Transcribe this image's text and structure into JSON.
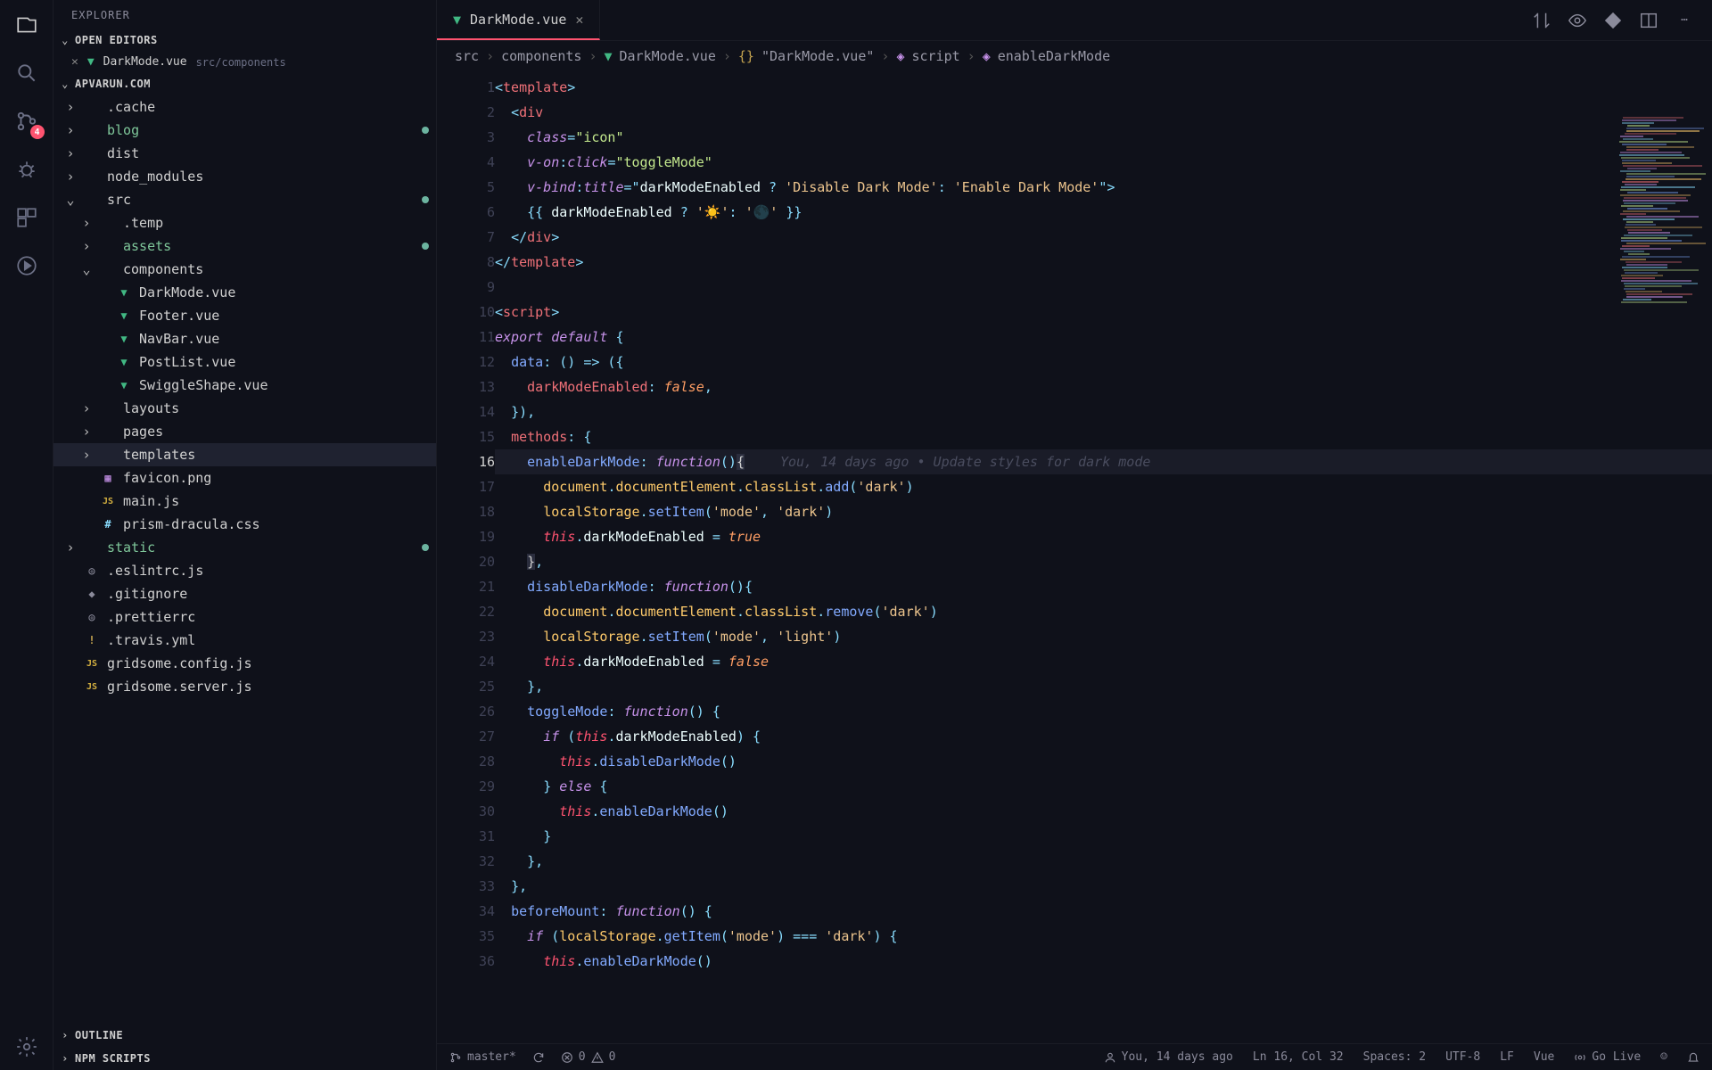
{
  "sidebar": {
    "title": "EXPLORER",
    "openEditorsLabel": "OPEN EDITORS",
    "openEditor": {
      "name": "DarkMode.vue",
      "path": "src/components"
    },
    "projectLabel": "APVARUN.COM",
    "outlineLabel": "OUTLINE",
    "npmLabel": "NPM SCRIPTS",
    "scmBadge": "4",
    "tree": [
      {
        "name": ".cache",
        "type": "folder",
        "depth": 0,
        "expanded": false
      },
      {
        "name": "blog",
        "type": "folder",
        "depth": 0,
        "expanded": false,
        "modified": true,
        "green": true
      },
      {
        "name": "dist",
        "type": "folder",
        "depth": 0,
        "expanded": false
      },
      {
        "name": "node_modules",
        "type": "folder",
        "depth": 0,
        "expanded": false
      },
      {
        "name": "src",
        "type": "folder",
        "depth": 0,
        "expanded": true,
        "modified": true
      },
      {
        "name": ".temp",
        "type": "folder",
        "depth": 1,
        "expanded": false
      },
      {
        "name": "assets",
        "type": "folder",
        "depth": 1,
        "expanded": false,
        "modified": true,
        "green": true
      },
      {
        "name": "components",
        "type": "folder",
        "depth": 1,
        "expanded": true
      },
      {
        "name": "DarkMode.vue",
        "type": "vue",
        "depth": 2
      },
      {
        "name": "Footer.vue",
        "type": "vue",
        "depth": 2
      },
      {
        "name": "NavBar.vue",
        "type": "vue",
        "depth": 2
      },
      {
        "name": "PostList.vue",
        "type": "vue",
        "depth": 2
      },
      {
        "name": "SwiggleShape.vue",
        "type": "vue",
        "depth": 2
      },
      {
        "name": "layouts",
        "type": "folder",
        "depth": 1,
        "expanded": false
      },
      {
        "name": "pages",
        "type": "folder",
        "depth": 1,
        "expanded": false
      },
      {
        "name": "templates",
        "type": "folder",
        "depth": 1,
        "expanded": false,
        "selected": true
      },
      {
        "name": "favicon.png",
        "type": "img",
        "depth": 1
      },
      {
        "name": "main.js",
        "type": "js",
        "depth": 1
      },
      {
        "name": "prism-dracula.css",
        "type": "css",
        "depth": 1
      },
      {
        "name": "static",
        "type": "folder",
        "depth": 0,
        "expanded": false,
        "modified": true,
        "green": true
      },
      {
        "name": ".eslintrc.js",
        "type": "gear",
        "depth": 0
      },
      {
        "name": ".gitignore",
        "type": "git",
        "depth": 0
      },
      {
        "name": ".prettierrc",
        "type": "gear",
        "depth": 0
      },
      {
        "name": ".travis.yml",
        "type": "warn",
        "depth": 0
      },
      {
        "name": "gridsome.config.js",
        "type": "js",
        "depth": 0
      },
      {
        "name": "gridsome.server.js",
        "type": "js",
        "depth": 0
      }
    ]
  },
  "tab": {
    "name": "DarkMode.vue"
  },
  "breadcrumbs": [
    "src",
    "components",
    "DarkMode.vue",
    "\"DarkMode.vue\"",
    "script",
    "enableDarkMode"
  ],
  "gitlens_inline": "You, 14 days ago • Update styles for dark mode",
  "currentLine": 16,
  "status": {
    "branch": "master*",
    "errors": "0",
    "warnings": "0",
    "blame": "You, 14 days ago",
    "lncol": "Ln 16, Col 32",
    "spaces": "Spaces: 2",
    "encoding": "UTF-8",
    "eol": "LF",
    "lang": "Vue",
    "golive": "Go Live"
  },
  "code": {
    "l1": [
      [
        "<",
        "tk-punc"
      ],
      [
        "template",
        "tk-tag"
      ],
      [
        ">",
        "tk-punc"
      ]
    ],
    "l2": [
      [
        "  ",
        ""
      ],
      [
        "<",
        "tk-punc"
      ],
      [
        "div",
        "tk-tag"
      ]
    ],
    "l3": [
      [
        "    ",
        ""
      ],
      [
        "class",
        "tk-attr"
      ],
      [
        "=",
        "tk-op"
      ],
      [
        "\"icon\"",
        "tk-str"
      ]
    ],
    "l4": [
      [
        "    ",
        ""
      ],
      [
        "v-on",
        "tk-attr"
      ],
      [
        ":",
        "tk-op"
      ],
      [
        "click",
        "tk-attr"
      ],
      [
        "=",
        "tk-op"
      ],
      [
        "\"toggleMode\"",
        "tk-str"
      ]
    ],
    "l5": [
      [
        "    ",
        ""
      ],
      [
        "v-bind",
        "tk-attr"
      ],
      [
        ":",
        "tk-op"
      ],
      [
        "title",
        "tk-attr"
      ],
      [
        "=",
        "tk-op"
      ],
      [
        "\"",
        "tk-punc"
      ],
      [
        "darkModeEnabled",
        "tk-id"
      ],
      [
        " ? ",
        "tk-op"
      ],
      [
        "'Disable Dark Mode'",
        "tk-str2"
      ],
      [
        ": ",
        "tk-op"
      ],
      [
        "'Enable Dark Mode'",
        "tk-str2"
      ],
      [
        "\"",
        "tk-punc"
      ],
      [
        ">",
        "tk-punc"
      ]
    ],
    "l6": [
      [
        "    ",
        ""
      ],
      [
        "{{ ",
        "tk-punc"
      ],
      [
        "darkModeEnabled",
        "tk-id"
      ],
      [
        " ? ",
        "tk-op"
      ],
      [
        "'",
        "tk-str2"
      ],
      [
        "☀️",
        "tk-emoji"
      ],
      [
        "'",
        "tk-str2"
      ],
      [
        ": ",
        "tk-op"
      ],
      [
        "'",
        "tk-str2"
      ],
      [
        "🌑",
        "tk-emoji"
      ],
      [
        "'",
        "tk-str2"
      ],
      [
        " }}",
        "tk-punc"
      ]
    ],
    "l7": [
      [
        "  ",
        ""
      ],
      [
        "</",
        "tk-punc"
      ],
      [
        "div",
        "tk-tag"
      ],
      [
        ">",
        "tk-punc"
      ]
    ],
    "l8": [
      [
        "</",
        "tk-punc"
      ],
      [
        "template",
        "tk-tag"
      ],
      [
        ">",
        "tk-punc"
      ]
    ],
    "l9": [
      [
        "",
        ""
      ]
    ],
    "l10": [
      [
        "<",
        "tk-punc"
      ],
      [
        "script",
        "tk-tag"
      ],
      [
        ">",
        "tk-punc"
      ]
    ],
    "l11": [
      [
        "export default",
        "tk-kw"
      ],
      [
        " {",
        "tk-punc"
      ]
    ],
    "l12": [
      [
        "  ",
        ""
      ],
      [
        "data",
        "tk-fn"
      ],
      [
        ": () ",
        "tk-op"
      ],
      [
        "=>",
        "tk-op"
      ],
      [
        " ({",
        "tk-punc"
      ]
    ],
    "l13": [
      [
        "    ",
        ""
      ],
      [
        "darkModeEnabled",
        "tk-prop"
      ],
      [
        ": ",
        "tk-op"
      ],
      [
        "false",
        "tk-bool"
      ],
      [
        ",",
        "tk-punc"
      ]
    ],
    "l14": [
      [
        "  ",
        ""
      ],
      [
        "}),",
        "tk-punc"
      ]
    ],
    "l15": [
      [
        "  ",
        ""
      ],
      [
        "methods",
        "tk-prop"
      ],
      [
        ": {",
        "tk-punc"
      ]
    ],
    "l16": [
      [
        "    ",
        ""
      ],
      [
        "enableDarkMode",
        "tk-fn"
      ],
      [
        ": ",
        "tk-op"
      ],
      [
        "function",
        "tk-kw"
      ],
      [
        "()",
        "tk-punc"
      ],
      [
        "{",
        "tk-cursor-bg"
      ]
    ],
    "l17": [
      [
        "      ",
        ""
      ],
      [
        "document",
        "tk-obj"
      ],
      [
        ".",
        "tk-punc"
      ],
      [
        "documentElement",
        "tk-obj"
      ],
      [
        ".",
        "tk-punc"
      ],
      [
        "classList",
        "tk-obj"
      ],
      [
        ".",
        "tk-punc"
      ],
      [
        "add",
        "tk-fn"
      ],
      [
        "(",
        "tk-punc"
      ],
      [
        "'dark'",
        "tk-str2"
      ],
      [
        ")",
        "tk-punc"
      ]
    ],
    "l18": [
      [
        "      ",
        ""
      ],
      [
        "localStorage",
        "tk-obj"
      ],
      [
        ".",
        "tk-punc"
      ],
      [
        "setItem",
        "tk-fn"
      ],
      [
        "(",
        "tk-punc"
      ],
      [
        "'mode'",
        "tk-str2"
      ],
      [
        ", ",
        "tk-punc"
      ],
      [
        "'dark'",
        "tk-str2"
      ],
      [
        ")",
        "tk-punc"
      ]
    ],
    "l19": [
      [
        "      ",
        ""
      ],
      [
        "this",
        "tk-this"
      ],
      [
        ".",
        "tk-punc"
      ],
      [
        "darkModeEnabled",
        "tk-id"
      ],
      [
        " = ",
        "tk-op"
      ],
      [
        "true",
        "tk-bool"
      ]
    ],
    "l20": [
      [
        "    ",
        ""
      ],
      [
        "}",
        "tk-cursor-bg"
      ],
      [
        ",",
        "tk-punc"
      ]
    ],
    "l21": [
      [
        "    ",
        ""
      ],
      [
        "disableDarkMode",
        "tk-fn"
      ],
      [
        ": ",
        "tk-op"
      ],
      [
        "function",
        "tk-kw"
      ],
      [
        "(){",
        "tk-punc"
      ]
    ],
    "l22": [
      [
        "      ",
        ""
      ],
      [
        "document",
        "tk-obj"
      ],
      [
        ".",
        "tk-punc"
      ],
      [
        "documentElement",
        "tk-obj"
      ],
      [
        ".",
        "tk-punc"
      ],
      [
        "classList",
        "tk-obj"
      ],
      [
        ".",
        "tk-punc"
      ],
      [
        "remove",
        "tk-fn"
      ],
      [
        "(",
        "tk-punc"
      ],
      [
        "'dark'",
        "tk-str2"
      ],
      [
        ")",
        "tk-punc"
      ]
    ],
    "l23": [
      [
        "      ",
        ""
      ],
      [
        "localStorage",
        "tk-obj"
      ],
      [
        ".",
        "tk-punc"
      ],
      [
        "setItem",
        "tk-fn"
      ],
      [
        "(",
        "tk-punc"
      ],
      [
        "'mode'",
        "tk-str2"
      ],
      [
        ", ",
        "tk-punc"
      ],
      [
        "'light'",
        "tk-str2"
      ],
      [
        ")",
        "tk-punc"
      ]
    ],
    "l24": [
      [
        "      ",
        ""
      ],
      [
        "this",
        "tk-this"
      ],
      [
        ".",
        "tk-punc"
      ],
      [
        "darkModeEnabled",
        "tk-id"
      ],
      [
        " = ",
        "tk-op"
      ],
      [
        "false",
        "tk-bool"
      ]
    ],
    "l25": [
      [
        "    ",
        ""
      ],
      [
        "},",
        "tk-punc"
      ]
    ],
    "l26": [
      [
        "    ",
        ""
      ],
      [
        "toggleMode",
        "tk-fn"
      ],
      [
        ": ",
        "tk-op"
      ],
      [
        "function",
        "tk-kw"
      ],
      [
        "() {",
        "tk-punc"
      ]
    ],
    "l27": [
      [
        "      ",
        ""
      ],
      [
        "if",
        "tk-kw"
      ],
      [
        " (",
        "tk-punc"
      ],
      [
        "this",
        "tk-this"
      ],
      [
        ".",
        "tk-punc"
      ],
      [
        "darkModeEnabled",
        "tk-id"
      ],
      [
        ") {",
        "tk-punc"
      ]
    ],
    "l28": [
      [
        "        ",
        ""
      ],
      [
        "this",
        "tk-this"
      ],
      [
        ".",
        "tk-punc"
      ],
      [
        "disableDarkMode",
        "tk-fn"
      ],
      [
        "()",
        "tk-punc"
      ]
    ],
    "l29": [
      [
        "      ",
        ""
      ],
      [
        "} ",
        "tk-punc"
      ],
      [
        "else",
        "tk-kw"
      ],
      [
        " {",
        "tk-punc"
      ]
    ],
    "l30": [
      [
        "        ",
        ""
      ],
      [
        "this",
        "tk-this"
      ],
      [
        ".",
        "tk-punc"
      ],
      [
        "enableDarkMode",
        "tk-fn"
      ],
      [
        "()",
        "tk-punc"
      ]
    ],
    "l31": [
      [
        "      ",
        ""
      ],
      [
        "}",
        "tk-punc"
      ]
    ],
    "l32": [
      [
        "    ",
        ""
      ],
      [
        "},",
        "tk-punc"
      ]
    ],
    "l33": [
      [
        "  ",
        ""
      ],
      [
        "},",
        "tk-punc"
      ]
    ],
    "l34": [
      [
        "  ",
        ""
      ],
      [
        "beforeMount",
        "tk-fn"
      ],
      [
        ": ",
        "tk-op"
      ],
      [
        "function",
        "tk-kw"
      ],
      [
        "() {",
        "tk-punc"
      ]
    ],
    "l35": [
      [
        "    ",
        ""
      ],
      [
        "if",
        "tk-kw"
      ],
      [
        " (",
        "tk-punc"
      ],
      [
        "localStorage",
        "tk-obj"
      ],
      [
        ".",
        "tk-punc"
      ],
      [
        "getItem",
        "tk-fn"
      ],
      [
        "(",
        "tk-punc"
      ],
      [
        "'mode'",
        "tk-str2"
      ],
      [
        ") === ",
        "tk-op"
      ],
      [
        "'dark'",
        "tk-str2"
      ],
      [
        ") {",
        "tk-punc"
      ]
    ],
    "l36": [
      [
        "      ",
        ""
      ],
      [
        "this",
        "tk-this"
      ],
      [
        ".",
        "tk-punc"
      ],
      [
        "enableDarkMode",
        "tk-fn"
      ],
      [
        "()",
        "tk-punc"
      ]
    ]
  }
}
